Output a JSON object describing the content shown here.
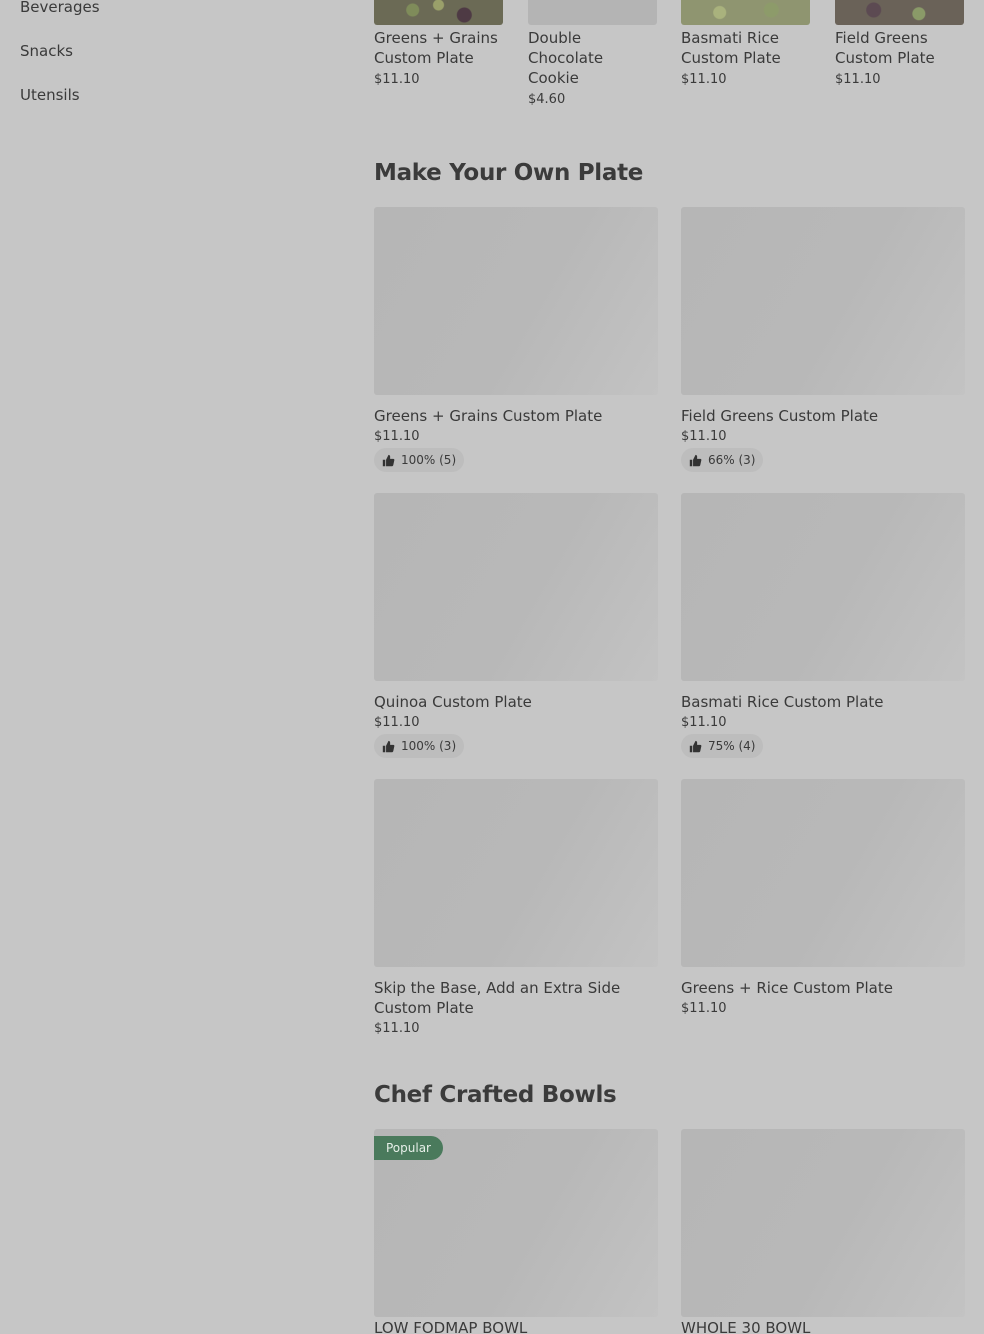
{
  "sidebar": {
    "items": [
      {
        "label": "Beverages"
      },
      {
        "label": "Snacks"
      },
      {
        "label": "Utensils"
      }
    ]
  },
  "top_items": [
    {
      "name": "Greens + Grains Custom Plate",
      "price": "$11.10"
    },
    {
      "name": "Double Chocolate Cookie",
      "price": "$4.60"
    },
    {
      "name": "Basmati Rice Custom Plate",
      "price": "$11.10"
    },
    {
      "name": "Field Greens Custom Plate",
      "price": "$11.10"
    }
  ],
  "sections": {
    "make_your_own": {
      "title": "Make Your Own Plate",
      "items": [
        {
          "name": "Greens + Grains Custom Plate",
          "price": "$11.10",
          "rating": "100% (5)"
        },
        {
          "name": "Field Greens Custom Plate",
          "price": "$11.10",
          "rating": "66% (3)"
        },
        {
          "name": "Quinoa Custom Plate",
          "price": "$11.10",
          "rating": "100% (3)"
        },
        {
          "name": "Basmati Rice Custom Plate",
          "price": "$11.10",
          "rating": "75% (4)"
        },
        {
          "name": "Skip the Base, Add an Extra Side Custom Plate",
          "price": "$11.10"
        },
        {
          "name": "Greens + Rice Custom Plate",
          "price": "$11.10"
        }
      ]
    },
    "chef_crafted": {
      "title": "Chef Crafted Bowls",
      "badge": "Popular",
      "items": [
        {
          "name": "LOW FODMAP BOWL"
        },
        {
          "name": "WHOLE 30 BOWL"
        }
      ]
    }
  },
  "icons": {
    "rating": "thumbs-up-icon"
  }
}
